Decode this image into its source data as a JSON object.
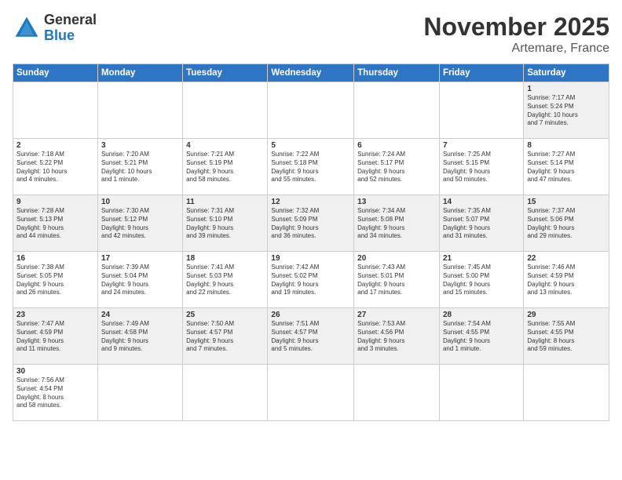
{
  "logo": {
    "general": "General",
    "blue": "Blue"
  },
  "title": "November 2025",
  "location": "Artemare, France",
  "days_of_week": [
    "Sunday",
    "Monday",
    "Tuesday",
    "Wednesday",
    "Thursday",
    "Friday",
    "Saturday"
  ],
  "weeks": [
    [
      {
        "day": "",
        "info": ""
      },
      {
        "day": "",
        "info": ""
      },
      {
        "day": "",
        "info": ""
      },
      {
        "day": "",
        "info": ""
      },
      {
        "day": "",
        "info": ""
      },
      {
        "day": "",
        "info": ""
      },
      {
        "day": "1",
        "info": "Sunrise: 7:17 AM\nSunset: 5:24 PM\nDaylight: 10 hours\nand 7 minutes."
      }
    ],
    [
      {
        "day": "2",
        "info": "Sunrise: 7:18 AM\nSunset: 5:22 PM\nDaylight: 10 hours\nand 4 minutes."
      },
      {
        "day": "3",
        "info": "Sunrise: 7:20 AM\nSunset: 5:21 PM\nDaylight: 10 hours\nand 1 minute."
      },
      {
        "day": "4",
        "info": "Sunrise: 7:21 AM\nSunset: 5:19 PM\nDaylight: 9 hours\nand 58 minutes."
      },
      {
        "day": "5",
        "info": "Sunrise: 7:22 AM\nSunset: 5:18 PM\nDaylight: 9 hours\nand 55 minutes."
      },
      {
        "day": "6",
        "info": "Sunrise: 7:24 AM\nSunset: 5:17 PM\nDaylight: 9 hours\nand 52 minutes."
      },
      {
        "day": "7",
        "info": "Sunrise: 7:25 AM\nSunset: 5:15 PM\nDaylight: 9 hours\nand 50 minutes."
      },
      {
        "day": "8",
        "info": "Sunrise: 7:27 AM\nSunset: 5:14 PM\nDaylight: 9 hours\nand 47 minutes."
      }
    ],
    [
      {
        "day": "9",
        "info": "Sunrise: 7:28 AM\nSunset: 5:13 PM\nDaylight: 9 hours\nand 44 minutes."
      },
      {
        "day": "10",
        "info": "Sunrise: 7:30 AM\nSunset: 5:12 PM\nDaylight: 9 hours\nand 42 minutes."
      },
      {
        "day": "11",
        "info": "Sunrise: 7:31 AM\nSunset: 5:10 PM\nDaylight: 9 hours\nand 39 minutes."
      },
      {
        "day": "12",
        "info": "Sunrise: 7:32 AM\nSunset: 5:09 PM\nDaylight: 9 hours\nand 36 minutes."
      },
      {
        "day": "13",
        "info": "Sunrise: 7:34 AM\nSunset: 5:08 PM\nDaylight: 9 hours\nand 34 minutes."
      },
      {
        "day": "14",
        "info": "Sunrise: 7:35 AM\nSunset: 5:07 PM\nDaylight: 9 hours\nand 31 minutes."
      },
      {
        "day": "15",
        "info": "Sunrise: 7:37 AM\nSunset: 5:06 PM\nDaylight: 9 hours\nand 29 minutes."
      }
    ],
    [
      {
        "day": "16",
        "info": "Sunrise: 7:38 AM\nSunset: 5:05 PM\nDaylight: 9 hours\nand 26 minutes."
      },
      {
        "day": "17",
        "info": "Sunrise: 7:39 AM\nSunset: 5:04 PM\nDaylight: 9 hours\nand 24 minutes."
      },
      {
        "day": "18",
        "info": "Sunrise: 7:41 AM\nSunset: 5:03 PM\nDaylight: 9 hours\nand 22 minutes."
      },
      {
        "day": "19",
        "info": "Sunrise: 7:42 AM\nSunset: 5:02 PM\nDaylight: 9 hours\nand 19 minutes."
      },
      {
        "day": "20",
        "info": "Sunrise: 7:43 AM\nSunset: 5:01 PM\nDaylight: 9 hours\nand 17 minutes."
      },
      {
        "day": "21",
        "info": "Sunrise: 7:45 AM\nSunset: 5:00 PM\nDaylight: 9 hours\nand 15 minutes."
      },
      {
        "day": "22",
        "info": "Sunrise: 7:46 AM\nSunset: 4:59 PM\nDaylight: 9 hours\nand 13 minutes."
      }
    ],
    [
      {
        "day": "23",
        "info": "Sunrise: 7:47 AM\nSunset: 4:59 PM\nDaylight: 9 hours\nand 11 minutes."
      },
      {
        "day": "24",
        "info": "Sunrise: 7:49 AM\nSunset: 4:58 PM\nDaylight: 9 hours\nand 9 minutes."
      },
      {
        "day": "25",
        "info": "Sunrise: 7:50 AM\nSunset: 4:57 PM\nDaylight: 9 hours\nand 7 minutes."
      },
      {
        "day": "26",
        "info": "Sunrise: 7:51 AM\nSunset: 4:57 PM\nDaylight: 9 hours\nand 5 minutes."
      },
      {
        "day": "27",
        "info": "Sunrise: 7:53 AM\nSunset: 4:56 PM\nDaylight: 9 hours\nand 3 minutes."
      },
      {
        "day": "28",
        "info": "Sunrise: 7:54 AM\nSunset: 4:55 PM\nDaylight: 9 hours\nand 1 minute."
      },
      {
        "day": "29",
        "info": "Sunrise: 7:55 AM\nSunset: 4:55 PM\nDaylight: 8 hours\nand 59 minutes."
      }
    ],
    [
      {
        "day": "30",
        "info": "Sunrise: 7:56 AM\nSunset: 4:54 PM\nDaylight: 8 hours\nand 58 minutes."
      },
      {
        "day": "",
        "info": ""
      },
      {
        "day": "",
        "info": ""
      },
      {
        "day": "",
        "info": ""
      },
      {
        "day": "",
        "info": ""
      },
      {
        "day": "",
        "info": ""
      },
      {
        "day": "",
        "info": ""
      }
    ]
  ]
}
